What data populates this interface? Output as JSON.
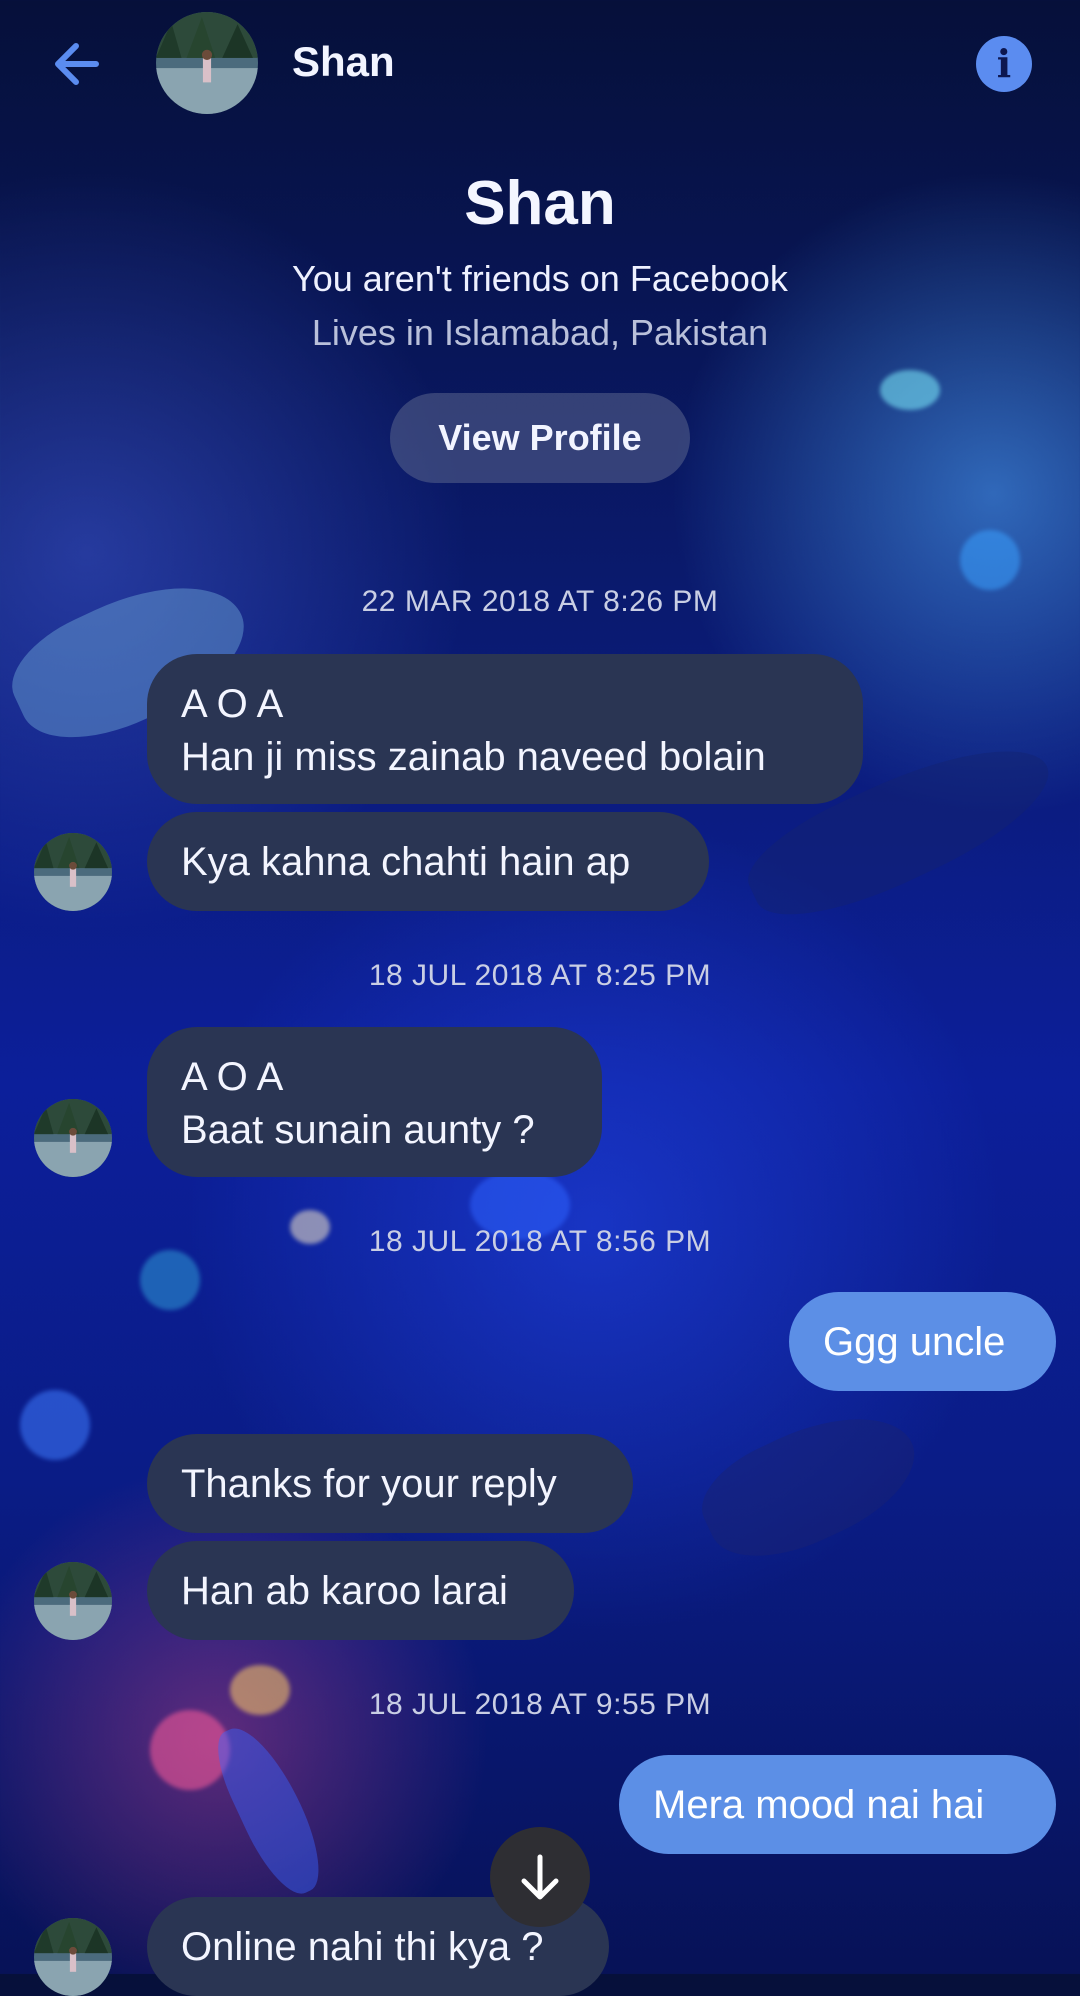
{
  "header": {
    "contact_name": "Shan",
    "back_icon": "arrow-left-icon",
    "info_icon": "info-icon",
    "info_glyph": "i",
    "accent_color": "#5b8cf0"
  },
  "profile": {
    "name": "Shan",
    "friends_status": "You aren't friends on Facebook",
    "location": "Lives in Islamabad, Pakistan",
    "view_profile_label": "View Profile"
  },
  "timestamps": [
    "22 MAR 2018 AT 8:26 PM",
    "18 JUL 2018 AT 8:25 PM",
    "18 JUL 2018 AT 8:56 PM",
    "18 JUL 2018 AT 9:55 PM"
  ],
  "messages": [
    {
      "direction": "received",
      "text": "A O A\nHan ji miss zainab naveed bolain"
    },
    {
      "direction": "received",
      "text": "Kya kahna chahti hain ap"
    },
    {
      "direction": "received",
      "text": "A O A\nBaat sunain aunty ?"
    },
    {
      "direction": "sent",
      "text": "Ggg uncle"
    },
    {
      "direction": "received",
      "text": "Thanks for your reply"
    },
    {
      "direction": "received",
      "text": "Han ab karoo larai"
    },
    {
      "direction": "sent",
      "text": "Mera mood nai hai"
    },
    {
      "direction": "received",
      "text": "Online nahi thi kya ?"
    }
  ],
  "colors": {
    "received_bubble": "#2a3553",
    "sent_bubble": "#5c8fe6"
  },
  "scroll_button_icon": "arrow-down-icon"
}
